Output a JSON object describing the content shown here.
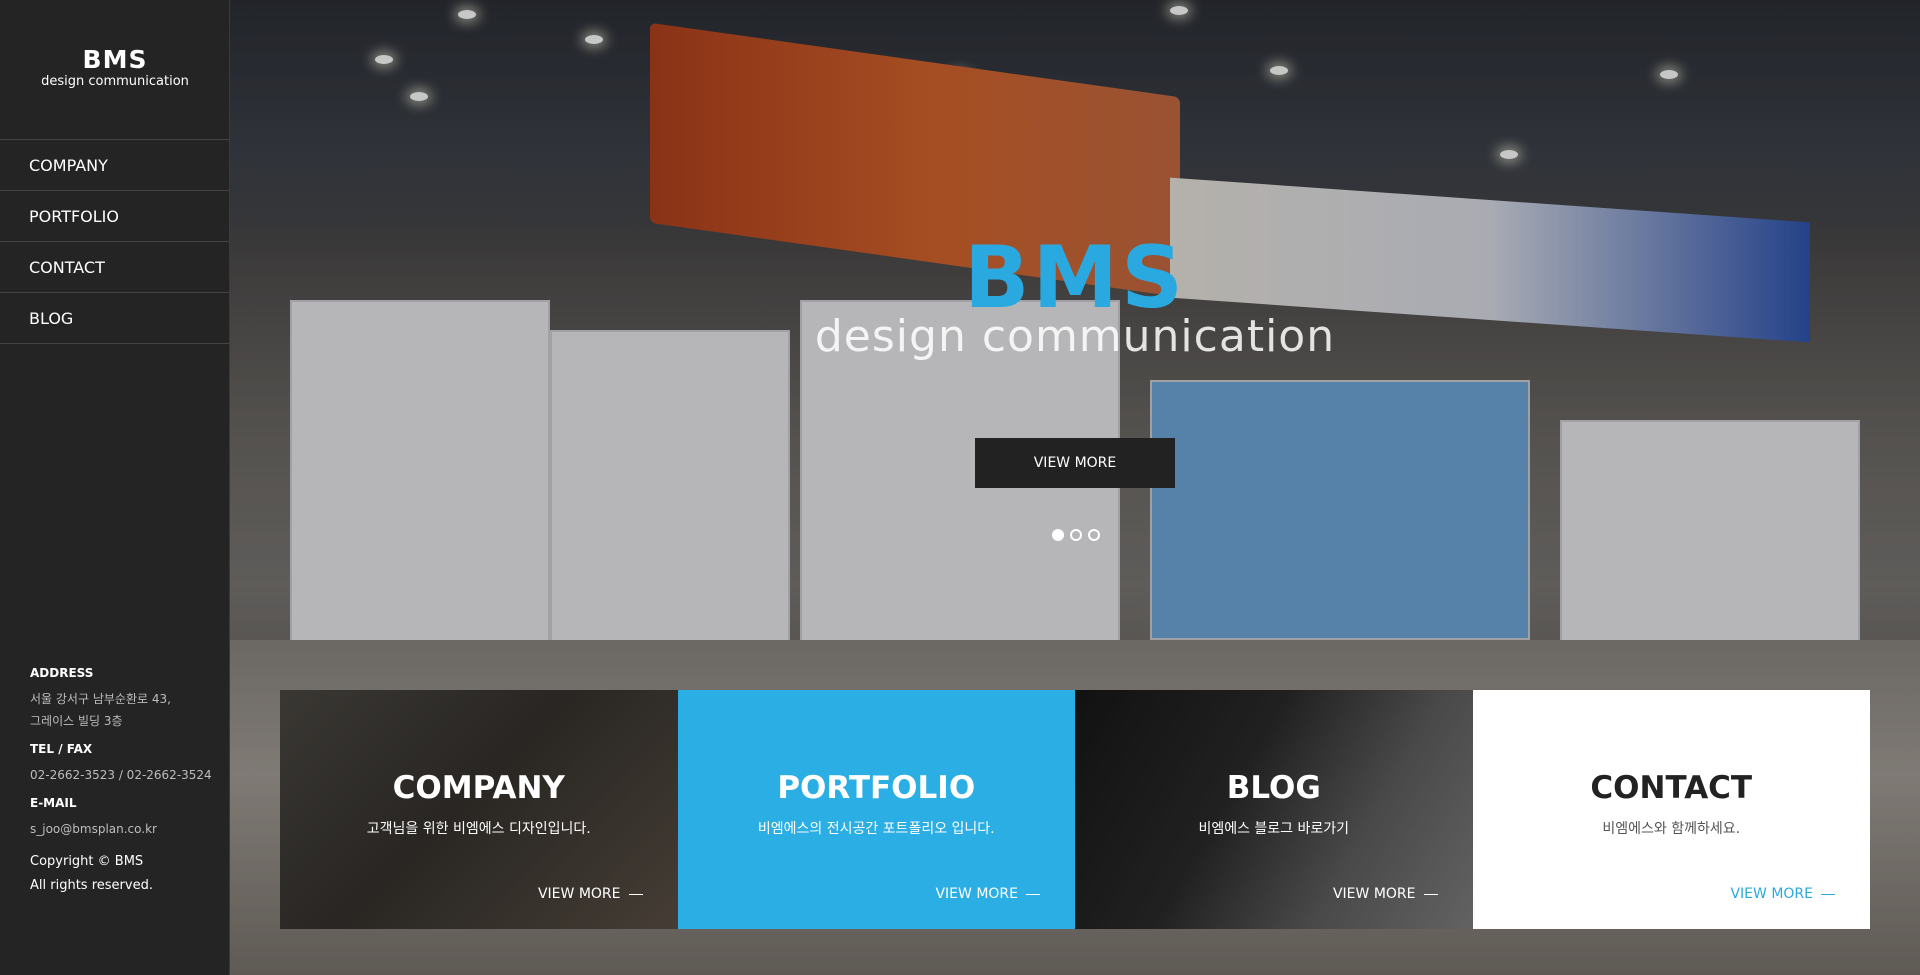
{
  "sidebar": {
    "logo_main": "BMS",
    "logo_sub": "design communication",
    "nav": [
      {
        "label": "COMPANY"
      },
      {
        "label": "PORTFOLIO"
      },
      {
        "label": "CONTACT"
      },
      {
        "label": "BLOG"
      }
    ],
    "address_label": "ADDRESS",
    "address_line1": "서울 강서구 남부순환로 43,",
    "address_line2": "그레이스 빌딩 3층",
    "tel_label": "TEL / FAX",
    "tel_value": "02-2662-3523 / 02-2662-3524",
    "email_label": "E-MAIL",
    "email_value": "s_joo@bmsplan.co.kr",
    "copyright_line1": "Copyright © BMS",
    "copyright_line2": "All rights reserved."
  },
  "hero": {
    "brand_main": "BMS",
    "brand_sub": "design communication",
    "button_label": "VIEW MORE",
    "slides": 3,
    "active_slide": 1
  },
  "cards": [
    {
      "title": "COMPANY",
      "desc": "고객님을 위한 비엠에스 디자인입니다.",
      "more": "VIEW MORE"
    },
    {
      "title": "PORTFOLIO",
      "desc": "비엠에스의 전시공간 포트폴리오 입니다.",
      "more": "VIEW MORE"
    },
    {
      "title": "BLOG",
      "desc": "비엠에스 블로그 바로가기",
      "more": "VIEW MORE"
    },
    {
      "title": "CONTACT",
      "desc": "비엠에스와 함께하세요.",
      "more": "VIEW MORE"
    }
  ],
  "colors": {
    "accent": "#2aa9e0",
    "sidebar_bg": "#242424",
    "button_bg": "#222222"
  }
}
